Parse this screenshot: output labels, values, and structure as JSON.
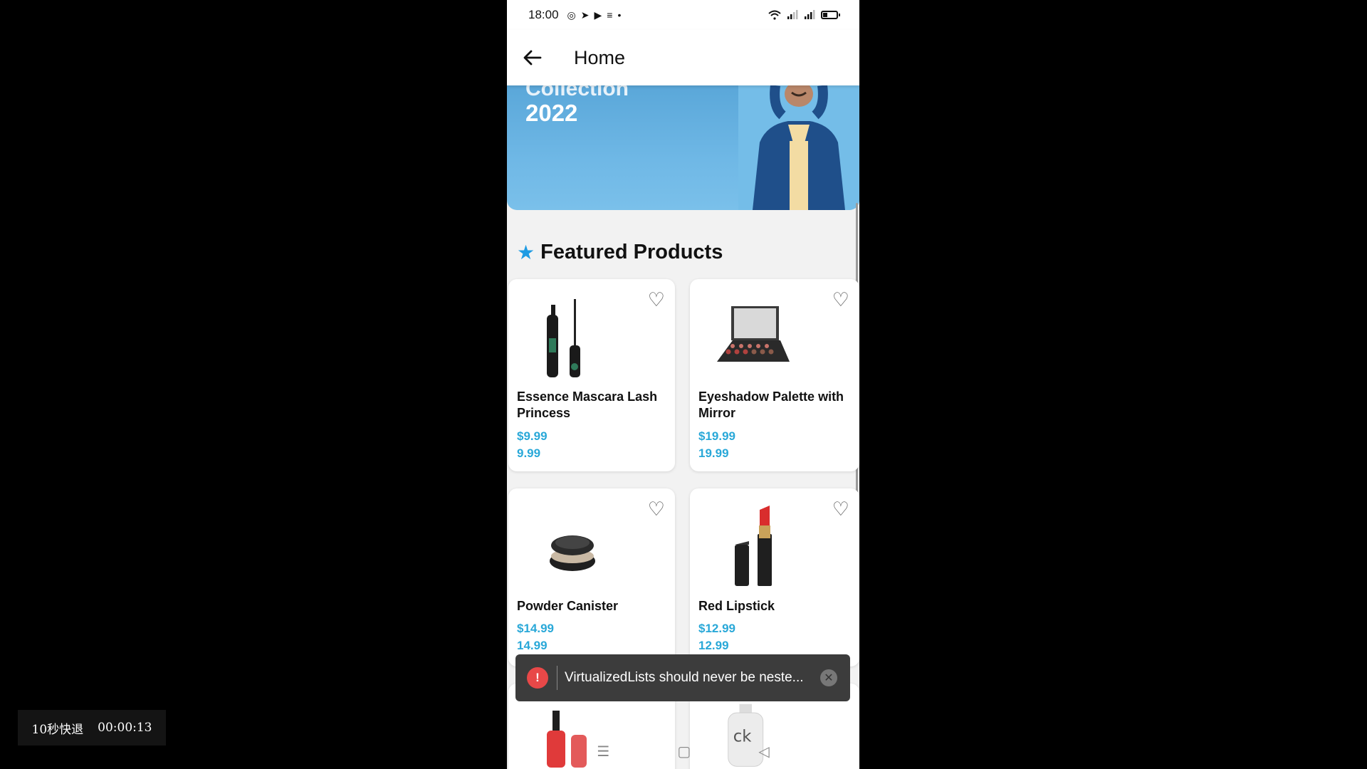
{
  "status_bar": {
    "time": "18:00",
    "left_icons": [
      "whatsapp-icon",
      "telegram-icon",
      "youtube-icon",
      "notes-icon",
      "dot-icon"
    ],
    "right_icons": [
      "wifi-icon",
      "signal-icon",
      "signal-icon",
      "battery-icon"
    ]
  },
  "header": {
    "title": "Home"
  },
  "banner": {
    "ghost_text": "Collection",
    "year_text": "2022"
  },
  "section": {
    "title": "Featured Products"
  },
  "products": [
    {
      "name": "Essence Mascara Lash Princess",
      "price": "$9.99",
      "raw_price": "9.99"
    },
    {
      "name": "Eyeshadow Palette with Mirror",
      "price": "$19.99",
      "raw_price": "19.99"
    },
    {
      "name": "Powder Canister",
      "price": "$14.99",
      "raw_price": "14.99"
    },
    {
      "name": "Red Lipstick",
      "price": "$12.99",
      "raw_price": "12.99"
    }
  ],
  "toast": {
    "message": "VirtualizedLists should never be neste..."
  },
  "overlay": {
    "rewind_label": "10秒快退",
    "elapsed": "00:00:13"
  },
  "colors": {
    "accent": "#1e9be3",
    "price": "#29a8d8",
    "error": "#e84848"
  }
}
